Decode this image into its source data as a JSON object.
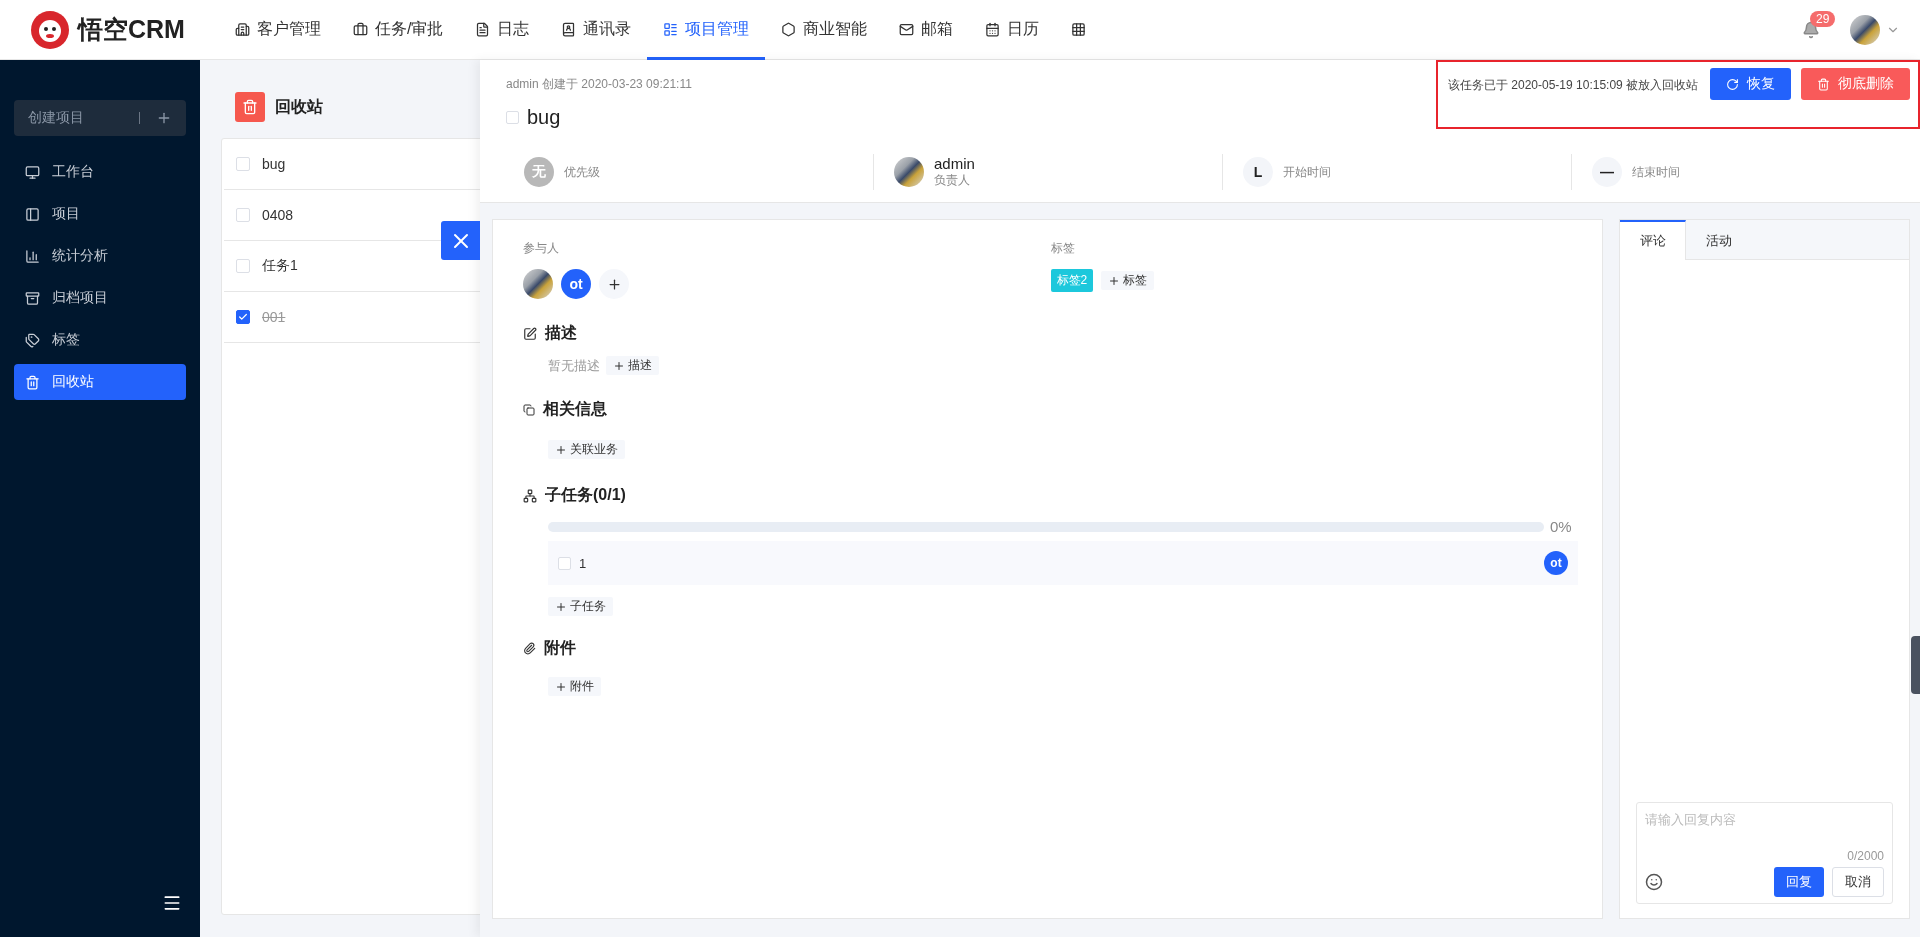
{
  "logo": {
    "text": "悟空CRM"
  },
  "nav": [
    {
      "label": "客户管理",
      "selected": false
    },
    {
      "label": "任务/审批",
      "selected": false
    },
    {
      "label": "日志",
      "selected": false
    },
    {
      "label": "通讯录",
      "selected": false
    },
    {
      "label": "项目管理",
      "selected": true
    },
    {
      "label": "商业智能",
      "selected": false
    },
    {
      "label": "邮箱",
      "selected": false
    },
    {
      "label": "日历",
      "selected": false
    }
  ],
  "notifications": {
    "count": "29"
  },
  "sidebar": {
    "create_button": "创建项目",
    "items": [
      {
        "label": "工作台",
        "selected": false
      },
      {
        "label": "项目",
        "selected": false
      },
      {
        "label": "统计分析",
        "selected": false
      },
      {
        "label": "归档项目",
        "selected": false
      },
      {
        "label": "标签",
        "selected": false
      },
      {
        "label": "回收站",
        "selected": true
      }
    ]
  },
  "recycle": {
    "title": "回收站",
    "tasks": [
      {
        "title": "bug",
        "checked": false
      },
      {
        "title": "0408",
        "checked": false
      },
      {
        "title": "任务1",
        "checked": false
      },
      {
        "title": "001",
        "checked": true
      }
    ]
  },
  "task": {
    "meta": "admin 创建于 2020-03-23 09:21:11",
    "title": "bug",
    "done": false,
    "deleted_note": "该任务已于 2020-05-19 10:15:09 被放入回收站",
    "restore": "恢复",
    "delete": "彻底删除",
    "fields": [
      {
        "kind": "badge",
        "badge": "无",
        "label": "优先级"
      },
      {
        "kind": "owner",
        "value": "admin",
        "label": "负责人"
      },
      {
        "kind": "date",
        "badge": "L",
        "label": "开始时间"
      },
      {
        "kind": "date",
        "badge": "—",
        "label": "结束时间"
      }
    ],
    "participants": {
      "label": "参与人",
      "members": [
        {
          "kind": "photo"
        },
        {
          "kind": "initials",
          "text": "ot"
        }
      ]
    },
    "tags": {
      "label": "标签",
      "items": [
        {
          "text": "标签2",
          "color": "#1cc8dc"
        }
      ],
      "add": "标签"
    },
    "description": {
      "title": "描述",
      "empty": "暂无描述",
      "add": "描述"
    },
    "related": {
      "title": "相关信息",
      "add": "关联业务"
    },
    "subtasks": {
      "title": "子任务(0/1)",
      "level": 0,
      "percent": "0%",
      "items": [
        {
          "title": "1",
          "checked": false,
          "assignee": "ot"
        }
      ],
      "add": "子任务"
    },
    "attachments": {
      "title": "附件",
      "add": "附件"
    }
  },
  "comments": {
    "tabs": [
      {
        "label": "评论",
        "selected": true
      },
      {
        "label": "活动",
        "selected": false
      }
    ],
    "placeholder": "请输入回复内容",
    "counter": "0/2000",
    "submit": "回复",
    "cancel": "取消"
  }
}
